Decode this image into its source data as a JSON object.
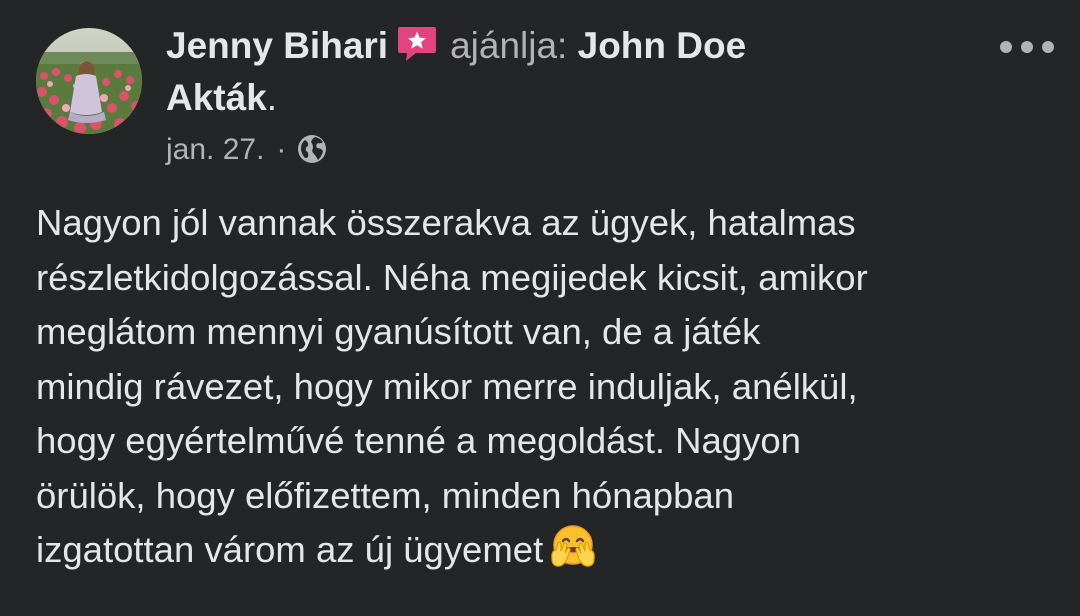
{
  "post": {
    "author": "Jenny Bihari",
    "verb": "ajánlja:",
    "page_name_line1": "John Doe",
    "page_name_line2": "Akták",
    "period": ".",
    "date": "jan. 27.",
    "separator": "·",
    "privacy_icon": "globe-icon",
    "badge_icon": "recommend-star-icon",
    "body_lines": [
      "Nagyon jól vannak összerakva az ügyek, hatalmas",
      "részletkidolgozással. Néha megijedek kicsit, amikor",
      "meglátom mennyi gyanúsított van, de a játék",
      "mindig rávezet, hogy mikor merre induljak, anélkül,",
      "hogy egyértelművé tenné a megoldást. Nagyon",
      "örülök, hogy előfizettem, minden hónapban",
      "izgatottan várom az új ügyemet"
    ],
    "emoji": "hugging-face-emoji"
  },
  "colors": {
    "background": "#242526",
    "primary_text": "#e4e6eb",
    "secondary_text": "#b0b3b8",
    "recommend_badge": "#e2457e"
  }
}
